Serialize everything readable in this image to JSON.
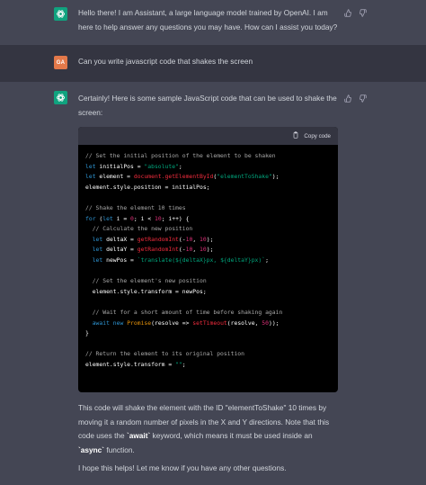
{
  "conversation": {
    "greeting": "Hello there! I am Assistant, a large language model trained by OpenAI. I am here to help answer any questions you may have. How can I assist you today?",
    "user_avatar": "GA",
    "user_message": "Can you write javascript code that shakes the screen",
    "reply_intro": "Certainly! Here is some sample JavaScript code that can be used to shake the screen:",
    "copy_label": "Copy code",
    "code_lines": [
      [
        [
          "comment",
          "// Set the initial position of the element to be shaken"
        ]
      ],
      [
        [
          "keyword",
          "let "
        ],
        [
          "plain",
          "initialPos = "
        ],
        [
          "string",
          "\"absolute\""
        ],
        [
          "plain",
          ";"
        ]
      ],
      [
        [
          "keyword",
          "let "
        ],
        [
          "plain",
          "element = "
        ],
        [
          "function",
          "document.getElementById"
        ],
        [
          "plain",
          "("
        ],
        [
          "string",
          "\"elementToShake\""
        ],
        [
          "plain",
          ");"
        ]
      ],
      [
        [
          "plain",
          "element.style.position = initialPos;"
        ]
      ],
      [],
      [
        [
          "comment",
          "// Shake the element 10 times"
        ]
      ],
      [
        [
          "keyword",
          "for "
        ],
        [
          "plain",
          "("
        ],
        [
          "keyword",
          "let "
        ],
        [
          "plain",
          "i = "
        ],
        [
          "number",
          "0"
        ],
        [
          "plain",
          "; i < "
        ],
        [
          "number",
          "10"
        ],
        [
          "plain",
          "; i++) {"
        ]
      ],
      [
        [
          "plain",
          "  "
        ],
        [
          "comment",
          "// Calculate the new position"
        ]
      ],
      [
        [
          "plain",
          "  "
        ],
        [
          "keyword",
          "let "
        ],
        [
          "plain",
          "deltaX = "
        ],
        [
          "function",
          "getRandomInt"
        ],
        [
          "plain",
          "(-"
        ],
        [
          "number",
          "10"
        ],
        [
          "plain",
          ", "
        ],
        [
          "number",
          "10"
        ],
        [
          "plain",
          ");"
        ]
      ],
      [
        [
          "plain",
          "  "
        ],
        [
          "keyword",
          "let "
        ],
        [
          "plain",
          "deltaY = "
        ],
        [
          "function",
          "getRandomInt"
        ],
        [
          "plain",
          "(-"
        ],
        [
          "number",
          "10"
        ],
        [
          "plain",
          ", "
        ],
        [
          "number",
          "10"
        ],
        [
          "plain",
          ");"
        ]
      ],
      [
        [
          "plain",
          "  "
        ],
        [
          "keyword",
          "let "
        ],
        [
          "plain",
          "newPos = "
        ],
        [
          "string",
          "`translate(${deltaX}px, ${deltaY}px)`"
        ],
        [
          "plain",
          ";"
        ]
      ],
      [],
      [
        [
          "plain",
          "  "
        ],
        [
          "comment",
          "// Set the element's new position"
        ]
      ],
      [
        [
          "plain",
          "  element.style.transform = newPos;"
        ]
      ],
      [],
      [
        [
          "plain",
          "  "
        ],
        [
          "comment",
          "// Wait for a short amount of time before shaking again"
        ]
      ],
      [
        [
          "plain",
          "  "
        ],
        [
          "keyword",
          "await new "
        ],
        [
          "class",
          "Promise"
        ],
        [
          "plain",
          "(resolve => "
        ],
        [
          "function",
          "setTimeout"
        ],
        [
          "plain",
          "(resolve, "
        ],
        [
          "number",
          "50"
        ],
        [
          "plain",
          "));"
        ]
      ],
      [
        [
          "plain",
          "}"
        ]
      ],
      [],
      [
        [
          "comment",
          "// Return the element to its original position"
        ]
      ],
      [
        [
          "plain",
          "element.style.transform = "
        ],
        [
          "string",
          "\"\""
        ],
        [
          "plain",
          ";"
        ]
      ]
    ],
    "explanation_parts": [
      "This code will shake the element with the ID \"elementToShake\" 10 times by moving it a random number of pixels in the X and Y directions. Note that this code uses the ",
      "`await`",
      " keyword, which means it must be used inside an ",
      "`async`",
      " function."
    ],
    "closing": "I hope this helps! Let me know if you have any other questions."
  },
  "icons": {
    "assistant_avatar": "openai-logo-icon",
    "thumbs_up": "thumbs-up-icon",
    "thumbs_down": "thumbs-down-icon",
    "copy": "clipboard-icon"
  },
  "colors": {
    "assistant_bg": "#444654",
    "user_bg": "#343541",
    "assistant_avatar": "#10a37f",
    "user_avatar": "#e3794a",
    "code_bg": "#000000"
  }
}
